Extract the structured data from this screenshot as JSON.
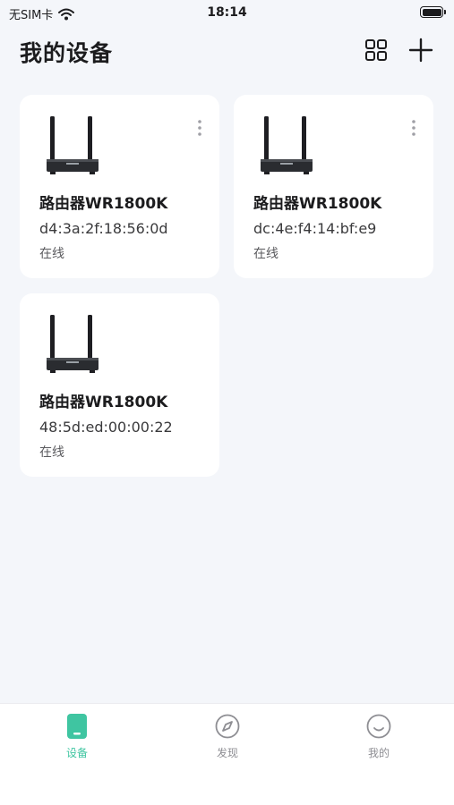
{
  "status": {
    "carrier": "无SIM卡",
    "time": "18:14"
  },
  "header": {
    "title": "我的设备"
  },
  "devices": [
    {
      "name": "路由器WR1800K",
      "mac": "d4:3a:2f:18:56:0d",
      "status": "在线"
    },
    {
      "name": "路由器WR1800K",
      "mac": "dc:4e:f4:14:bf:e9",
      "status": "在线"
    },
    {
      "name": "路由器WR1800K",
      "mac": "48:5d:ed:00:00:22",
      "status": "在线"
    }
  ],
  "tabs": [
    {
      "label": "设备",
      "icon": "device-icon",
      "active": true
    },
    {
      "label": "发现",
      "icon": "compass-icon",
      "active": false
    },
    {
      "label": "我的",
      "icon": "smile-icon",
      "active": false
    }
  ],
  "colors": {
    "accent": "#3fc5a1",
    "background": "#f4f6fa",
    "card": "#ffffff"
  }
}
